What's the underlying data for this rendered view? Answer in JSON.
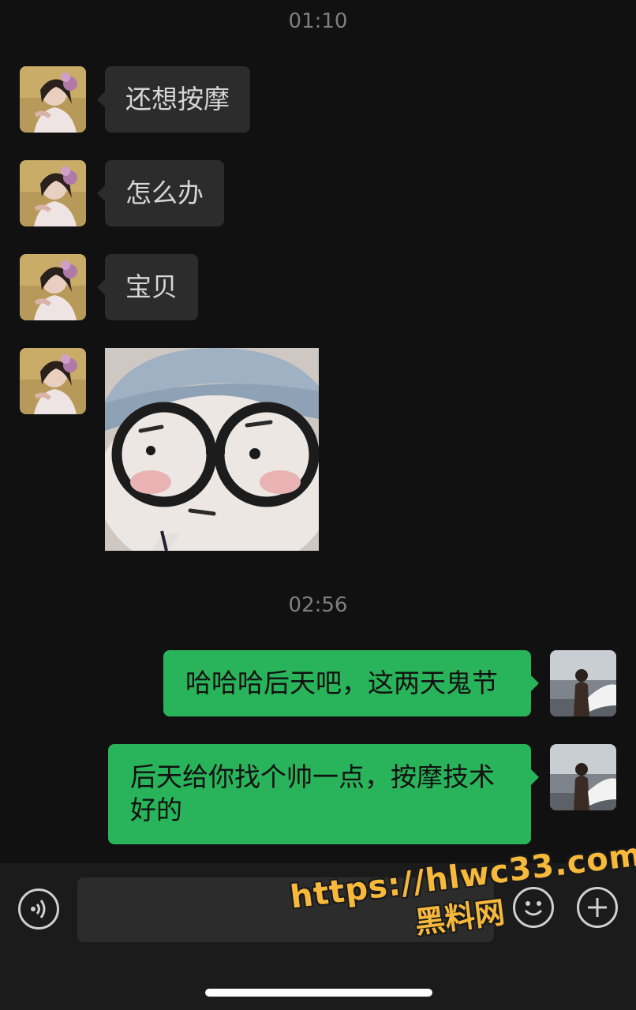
{
  "timestamps": [
    "01:10",
    "02:56"
  ],
  "messages": [
    {
      "side": "left",
      "type": "text",
      "text": "还想按摩"
    },
    {
      "side": "left",
      "type": "text",
      "text": "怎么办"
    },
    {
      "side": "left",
      "type": "text",
      "text": "宝贝"
    },
    {
      "side": "left",
      "type": "image",
      "image": "glasses-cartoon-sticker"
    },
    {
      "side": "right",
      "type": "text",
      "text": "哈哈哈后天吧，这两天鬼节"
    },
    {
      "side": "right",
      "type": "text",
      "text": "后天给你找个帅一点，按摩技术好的"
    }
  ],
  "input_bar": {
    "voice_icon": "voice-wave-icon",
    "emoji_icon": "smiley-icon",
    "plus_icon": "plus-icon",
    "text": ""
  },
  "watermark": {
    "url": "https://hlwc33.com",
    "name": "黑料网"
  },
  "colors": {
    "background": "#111111",
    "incoming_bubble": "#2c2c2c",
    "outgoing_bubble": "#29b35a",
    "watermark": "#f7b93b"
  }
}
